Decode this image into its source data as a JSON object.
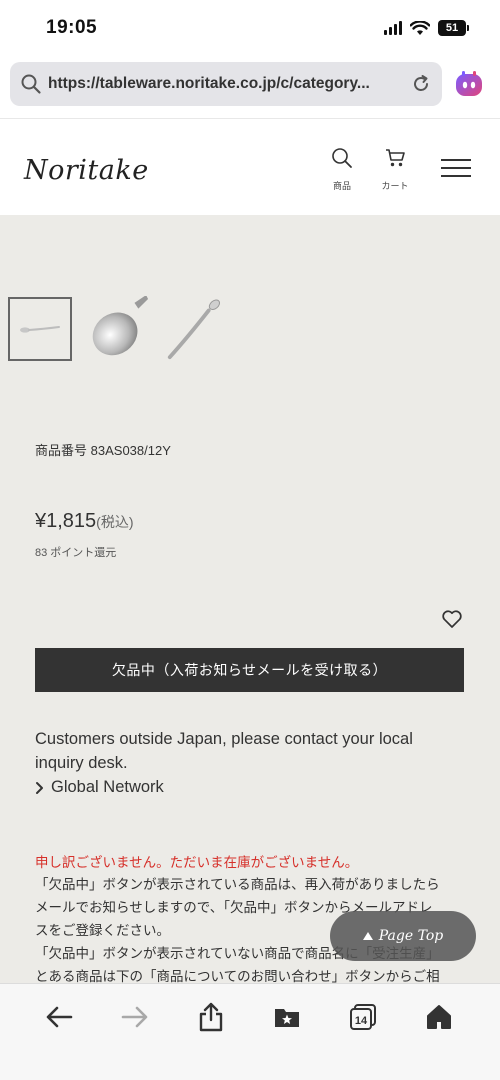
{
  "status": {
    "time": "19:05",
    "battery": "51"
  },
  "browser": {
    "url": "https://tableware.noritake.co.jp/c/category..."
  },
  "header": {
    "logo": "Noritake",
    "search_label": "商品",
    "cart_label": "カート"
  },
  "product": {
    "code_label": "商品番号",
    "code": "83AS038/12Y",
    "price": "¥1,815",
    "tax_note": "(税込)",
    "points": "83 ポイント還元",
    "sold_out_button": "欠品中（入荷お知らせメールを受け取る）"
  },
  "international": {
    "message": "Customers outside Japan, please contact your local inquiry desk.",
    "link": "Global Network"
  },
  "notice": {
    "headline": "申し訳ございません。ただいま在庫がございません。",
    "lines": [
      "「欠品中」ボタンが表示されている商品は、再入荷がありましたら",
      "メールでお知らせしますので、「欠品中」ボタンからメールアドレ",
      "スをご登録ください。",
      "「欠品中」ボタンが表示されていない商品で商品名に「受注生産」",
      "とある商品は下の「商品についてのお問い合わせ」ボタンからご相"
    ]
  },
  "page_top": "Page Top",
  "toolbar": {
    "tabs_count": "14"
  },
  "icons": {
    "search": "search-icon",
    "reload": "reload-icon",
    "extension": "copilot-icon",
    "cart": "cart-icon",
    "menu": "hamburger-icon",
    "favorite": "heart-icon",
    "back": "back-arrow-icon",
    "forward": "forward-arrow-icon",
    "share": "share-icon",
    "bookmarks": "bookmarks-icon",
    "tabs": "tabs-icon",
    "home": "home-icon"
  }
}
